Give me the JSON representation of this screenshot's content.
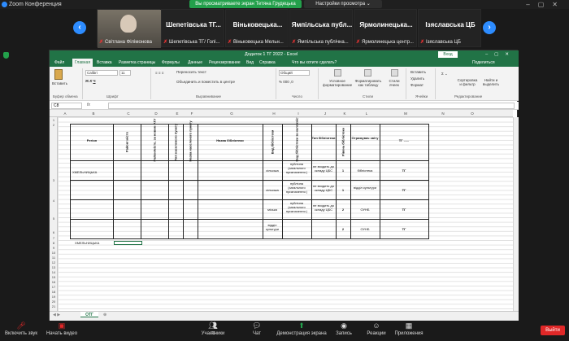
{
  "zoom": {
    "title": "Zoom Конференция",
    "share_banner": "Вы просматриваете экран Тетяна Грудецька",
    "view_options": "Настройки просмотра ⌄"
  },
  "participants": [
    {
      "label": "Світлана Філімонова",
      "big": ""
    },
    {
      "label": "Шепетівська ТГ/ Голі...",
      "big": "Шепетівська ТГ..."
    },
    {
      "label": "Віньковецька Мельн...",
      "big": "Віньковецька..."
    },
    {
      "label": "Ямпільська публічна...",
      "big": "Ямпільська публ..."
    },
    {
      "label": "Ярмолинецька центр...",
      "big": "Ярмолинецька..."
    },
    {
      "label": "Ізяславська ЦБ",
      "big": "Ізяславська ЦБ"
    }
  ],
  "excel": {
    "title": "Додаток 1 ТГ 2022  -  Excel",
    "login": "Вход",
    "tabs": [
      "Файл",
      "Главная",
      "Вставка",
      "Разметка страницы",
      "Формулы",
      "Данные",
      "Рецензирование",
      "Вид",
      "Справка",
      "Что вы хотите сделать?",
      "Поделиться"
    ],
    "ribbon": {
      "paste": "Вставить",
      "clipboard": "Буфер обмена",
      "font_name": "Calibri",
      "font_size": "11",
      "font_group": "Шрифт",
      "wrap": "Переносить текст",
      "merge": "Объединить и поместить в центре",
      "align_group": "Выравнивание",
      "number_format": "Общий",
      "number_group": "Число",
      "cond_format": "Условное форматирование",
      "format_table": "Форматировать как таблицу",
      "styles": "Стили ячеек",
      "styles_group": "Стили",
      "insert": "Вставить",
      "delete": "Удалить",
      "format": "Формат",
      "cells_group": "Ячейки",
      "sort": "Сортировка и фильтр",
      "find": "Найти и выделить",
      "edit_group": "Редактирование"
    },
    "namebox": "C8",
    "fx": "fx",
    "columns": [
      "A",
      "B",
      "C",
      "D",
      "E",
      "F",
      "G",
      "H",
      "I",
      "J",
      "K",
      "L",
      "M",
      "N",
      "O"
    ],
    "table": {
      "headers": {
        "region": "Регіон",
        "district": "Район/ місто",
        "raion": "Район/місто, за новим АТУ",
        "pop_point": "Тип населеного пункту",
        "pop_name": "Назва населеного пункту",
        "lib_name": "Назва бібліотеки",
        "lib_type": "Вид бібліотеки",
        "lib_kind": "Вид бібліотеки за належністю",
        "type": "Тип бібліотеки",
        "level": "Рівень бібліотеки",
        "receiver": "Отримувач звіту",
        "tg": "ТГ ......"
      },
      "rows": [
        {
          "region": "ХМЕЛЬНИЦЬКА",
          "settlement": "сільська",
          "kind": "публічна (загального призначення )",
          "type": "не входить до складу ЦБС",
          "level": "1",
          "receiver": "бібліотека",
          "tg": "ТГ"
        },
        {
          "region": "",
          "settlement": "сільська",
          "kind": "публічна (загального призначення )",
          "type": "не входить до складу ЦБС",
          "level": "1",
          "receiver": "відділ культури",
          "tg": "ТГ"
        },
        {
          "region": "",
          "settlement": "міська",
          "kind": "публічна (загального призначення )",
          "type": "не входить до складу ЦБС",
          "level": "2",
          "receiver": "ОУНБ",
          "tg": "ТГ"
        },
        {
          "region": "",
          "settlement": "відділ культури",
          "kind": "",
          "type": "",
          "level": "2",
          "receiver": "ОУНБ",
          "tg": "ТГ"
        }
      ],
      "a8": "ХМЕЛЬНИЦЬКА"
    },
    "sheet_tab": "ОТГ"
  },
  "toolbar": {
    "audio": "Включить звук",
    "video": "Начать видео",
    "participants": "Участники",
    "participants_count": "41",
    "chat": "Чат",
    "share": "Демонстрация экрана",
    "record": "Запись",
    "reactions": "Реакции",
    "apps": "Приложения",
    "leave": "Выйти"
  }
}
